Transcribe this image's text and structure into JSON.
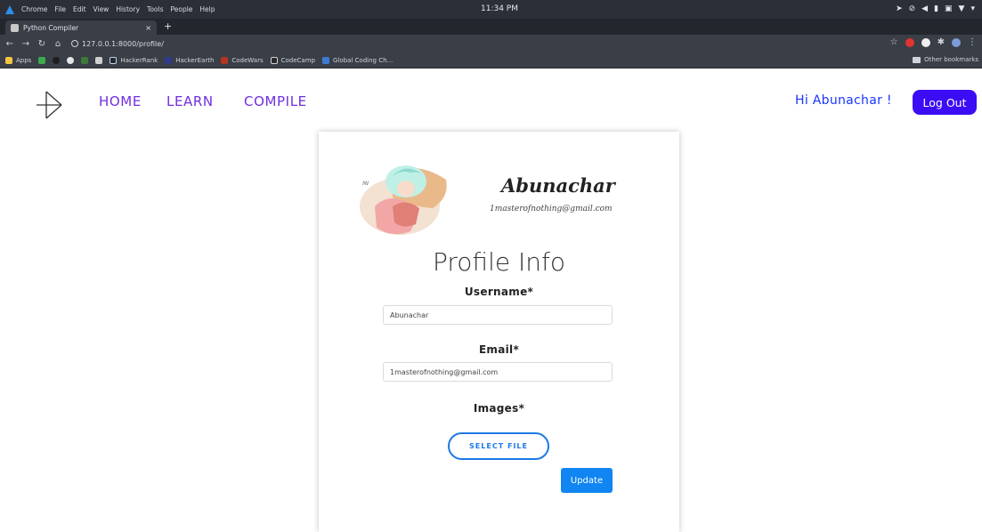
{
  "os_bar": {
    "app_name": "Chrome",
    "menu": [
      "File",
      "Edit",
      "View",
      "History",
      "Tools",
      "People",
      "Help"
    ],
    "clock": "11:34 PM",
    "tray_icons": [
      "send-icon",
      "link-icon",
      "volume-icon",
      "battery-icon",
      "keyboard-icon",
      "wifi-icon",
      "dropdown-icon"
    ]
  },
  "browser": {
    "tab_title": "Python Compiler",
    "tab_close": "×",
    "new_tab": "+",
    "url": "127.0.0.1:8000/profile/",
    "bookmarks": [
      "Apps",
      "HackerRank",
      "HackerEarth",
      "CodeWars",
      "CodeCamp",
      "Global Coding Ch..."
    ],
    "other_bookmarks": "Other bookmarks",
    "colors": {
      "os_bar": "#2c2f38",
      "toolbar": "#3a3e47"
    }
  },
  "site": {
    "nav": {
      "home": "HOME",
      "learn": "LEARN",
      "compile": "COMPILE"
    },
    "greeting": "Hi Abunachar !",
    "logout": "Log Out",
    "colors": {
      "nav": "#6f2fe0",
      "greeting": "#1a36ff",
      "logout_bg": "#3c0cf5"
    }
  },
  "profile": {
    "display_name": "Abunachar",
    "display_email": "1masterofnothing@gmail.com",
    "title": "Profile Info",
    "username_label": "Username*",
    "username_value": "Abunachar",
    "email_label": "Email*",
    "email_value": "1masterofnothing@gmail.com",
    "images_label": "Images*",
    "select_file": "SELECT FILE",
    "update": "Update",
    "colors": {
      "select_file": "#1d7ae6",
      "update_bg": "#1185f2"
    }
  }
}
